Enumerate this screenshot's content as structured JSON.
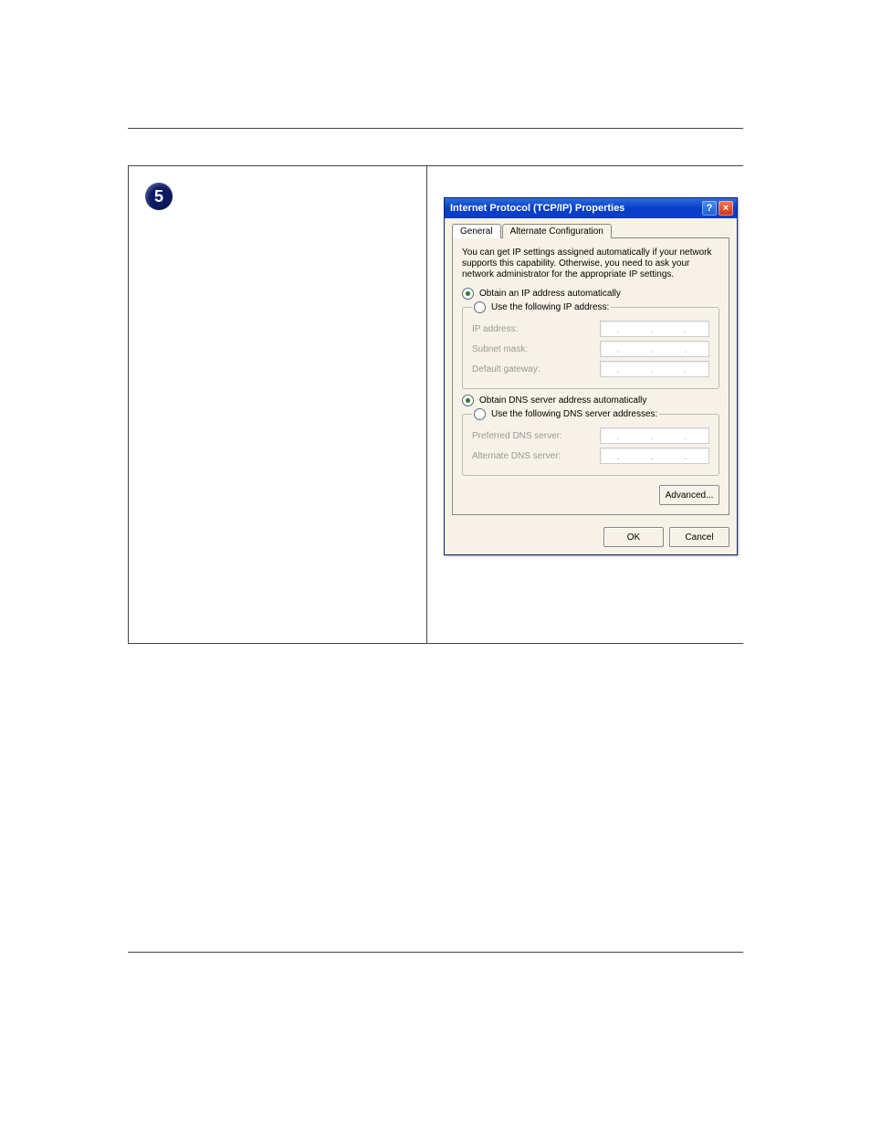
{
  "step": {
    "number": "5"
  },
  "dialog": {
    "title": "Internet Protocol (TCP/IP) Properties",
    "tabs": [
      "General",
      "Alternate Configuration"
    ],
    "active_tab_index": 0,
    "description": "You can get IP settings assigned automatically if your network supports this capability. Otherwise, you need to ask your network administrator for the appropriate IP settings.",
    "ip_section": {
      "auto_label": "Obtain an IP address automatically",
      "manual_label": "Use the following IP address:",
      "selected": "auto",
      "fields": {
        "ip_address": "IP address:",
        "subnet_mask": "Subnet mask:",
        "default_gateway": "Default gateway:"
      }
    },
    "dns_section": {
      "auto_label": "Obtain DNS server address automatically",
      "manual_label": "Use the following DNS server addresses:",
      "selected": "auto",
      "fields": {
        "preferred": "Preferred DNS server:",
        "alternate": "Alternate DNS server:"
      }
    },
    "buttons": {
      "advanced": "Advanced...",
      "ok": "OK",
      "cancel": "Cancel"
    }
  }
}
